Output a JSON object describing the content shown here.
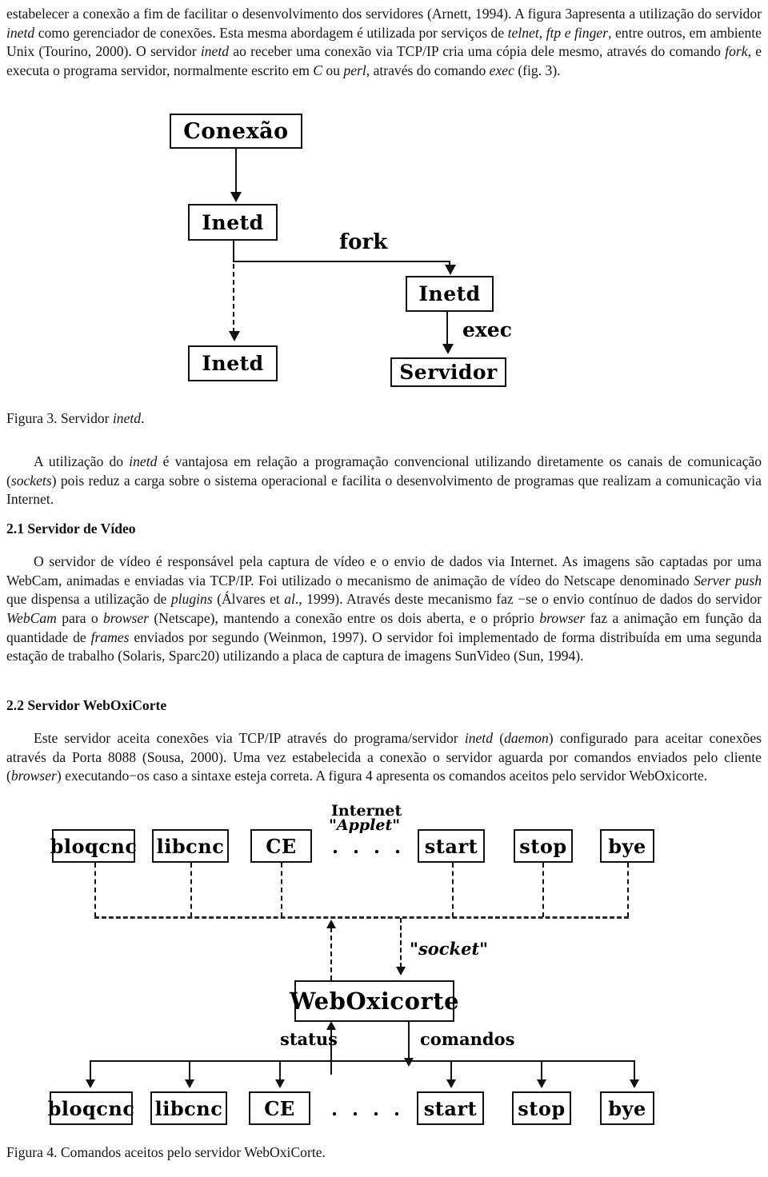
{
  "document": {
    "paragraphs": {
      "p1_a": "estabelecer a conexão  a fim de facilitar o desenvolvimento dos servidores (Arnett, 1994). A figura 3apresenta a utilização do servidor ",
      "p1_inetd": "inetd",
      "p1_b": " como gerenciador de conexões. Esta mesma abordagem é utilizada por serviços de ",
      "p1_telnetftp": "telnet, ftp e finger",
      "p1_c": ", entre outros, em ambiente Unix (Tourino, 2000). O servidor ",
      "p1_inetd2": "inetd",
      "p1_d": " ao receber uma conexão via TCP/IP cria uma cópia dele mesmo, através do comando ",
      "p1_fork": "fork",
      "p1_e": ", e executa o programa servidor, normalmente escrito em ",
      "p1_c_lang": "C",
      "p1_f": " ou ",
      "p1_perl": "perl",
      "p1_g": ", através do comando ",
      "p1_exec": "exec",
      "p1_h": " (fig. 3).",
      "p2_a": "A utilização do ",
      "p2_inetd": "inetd",
      "p2_b": " é vantajosa  em relação a programação convencional utilizando diretamente os canais de comunicação (",
      "p2_sockets": "sockets",
      "p2_c": ") pois reduz a carga sobre o sistema operacional e facilita o desenvolvimento de programas que realizam a comunicação via Internet.",
      "p3_a": "O servidor de vídeo é responsável pela captura de vídeo e o envio de dados via Internet. As imagens são captadas por uma WebCam, animadas e enviadas via TCP/IP. Foi utilizado o mecanismo de animação de vídeo do Netscape denominado ",
      "p3_serverpush": "Server push",
      "p3_b": " que dispensa a utilização de ",
      "p3_plugins": "plugins",
      "p3_c": "  (Álvares et ",
      "p3_al": "al",
      "p3_d": "., 1999). Através deste mecanismo faz −se o envio contínuo de dados do servidor ",
      "p3_webcam": "WebCam",
      "p3_e": " para o ",
      "p3_browser": "browser",
      "p3_f": " (Netscape), mantendo a conexão entre os dois aberta, e o próprio ",
      "p3_browser2": "browser",
      "p3_g": " faz a animação em função da quantidade de ",
      "p3_frames": "frames",
      "p3_h": " enviados por segundo (Weinmon, 1997). O servidor foi implementado de forma distribuída em uma segunda estação de trabalho (Solaris, Sparc20) utilizando a placa de captura de imagens SunVideo (Sun, 1994).",
      "p4_a": "Este servidor aceita conexões via TCP/IP através do programa/servidor  ",
      "p4_inetd": "inetd",
      "p4_b": "  (",
      "p4_daemon": "daemon",
      "p4_c": ") configurado para aceitar conexões através da Porta 8088 (Sousa, 2000). Uma vez estabelecida a conexão o servidor aguarda por comandos enviados pelo cliente (",
      "p4_browser": "browser",
      "p4_d": ") executando−os caso a sintaxe esteja correta. A figura 4 apresenta os comandos aceitos pelo servidor WebOxicorte."
    },
    "sections": {
      "s21": "2.1 Servidor de Vídeo",
      "s22": "2.2  Servidor WebOxiCorte"
    },
    "captions": {
      "fig3_a": "Figura 3. Servidor ",
      "fig3_it": "inetd",
      "fig3_b": ".",
      "fig4": "Figura 4. Comandos aceitos pelo servidor WebOxiCorte."
    }
  },
  "figure3": {
    "nodes": {
      "conexao": "Conexão",
      "inetd_main": "Inetd",
      "inetd_child_left": "Inetd",
      "inetd_child_right": "Inetd",
      "servidor": "Servidor"
    },
    "edge_labels": {
      "fork": "fork",
      "exec": "exec"
    }
  },
  "figure4": {
    "top_commands": [
      "bloqcnc",
      "libcnc",
      "CE",
      "start",
      "stop",
      "bye"
    ],
    "bottom_commands": [
      "bloqcnc",
      "libcnc",
      "CE",
      "start",
      "stop",
      "bye"
    ],
    "labels": {
      "internet": "Internet",
      "applet": "\"Applet\"",
      "socket": "\"socket\"",
      "status": "status",
      "comandos": "comandos",
      "ellipsis_top": ". . . .",
      "ellipsis_bottom": ". . . ."
    },
    "server": "WebOxicorte"
  },
  "colors": {
    "text": "#161616",
    "stroke": "#111111",
    "background": "#ffffff"
  }
}
